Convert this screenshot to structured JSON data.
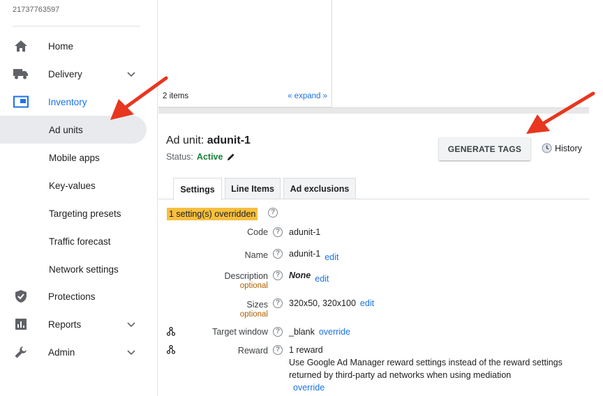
{
  "sidebar": {
    "network_id": "21737763597",
    "items": [
      {
        "label": "Home"
      },
      {
        "label": "Delivery"
      },
      {
        "label": "Inventory"
      },
      {
        "label": "Ad units"
      },
      {
        "label": "Mobile apps"
      },
      {
        "label": "Key-values"
      },
      {
        "label": "Targeting presets"
      },
      {
        "label": "Traffic forecast"
      },
      {
        "label": "Network settings"
      },
      {
        "label": "Protections"
      },
      {
        "label": "Reports"
      },
      {
        "label": "Admin"
      }
    ]
  },
  "list_pane": {
    "count": "2 items",
    "expand": "« expand »"
  },
  "ad_unit": {
    "title_prefix": "Ad unit: ",
    "name": "adunit-1",
    "status_label": "Status:",
    "status_value": "Active",
    "generate_tags": "GENERATE TAGS",
    "history": "History"
  },
  "tabs": [
    {
      "label": "Settings"
    },
    {
      "label": "Line Items"
    },
    {
      "label": "Ad exclusions"
    }
  ],
  "settings": {
    "overridden_badge": "1 setting(s) overridden",
    "help_glyph": "?",
    "code": {
      "label": "Code",
      "value": "adunit-1"
    },
    "name": {
      "label": "Name",
      "value": "adunit-1",
      "action": "edit"
    },
    "description": {
      "label": "Description",
      "optional": "optional",
      "value": "None",
      "action": "edit"
    },
    "sizes": {
      "label": "Sizes",
      "optional": "optional",
      "value": "320x50, 320x100",
      "action": "edit"
    },
    "target_window": {
      "label": "Target window",
      "value": "_blank",
      "action": "override"
    },
    "reward": {
      "label": "Reward",
      "value": "1 reward",
      "description": "Use Google Ad Manager reward settings instead of the reward settings returned by third-party ad networks when using mediation",
      "action": "override"
    }
  },
  "colors": {
    "accent": "#1a73e8",
    "active_status": "#188038",
    "override_badge": "#f6bf40",
    "arrow": "#e8361f"
  }
}
